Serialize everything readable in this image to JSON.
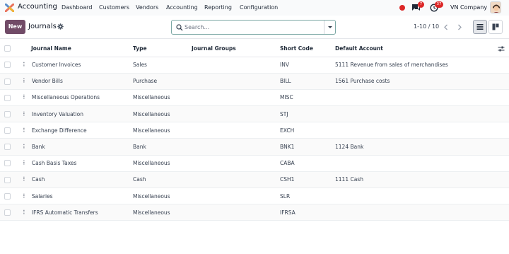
{
  "app": {
    "name": "Accounting",
    "menu": [
      "Dashboard",
      "Customers",
      "Vendors",
      "Accounting",
      "Reporting",
      "Configuration"
    ],
    "chat_count": "7",
    "activity_count": "37",
    "company": "VN Company"
  },
  "control_panel": {
    "new_label": "New",
    "title": "Journals",
    "search_placeholder": "Search...",
    "pager": "1-10 / 10"
  },
  "table": {
    "columns": [
      "Journal Name",
      "Type",
      "Journal Groups",
      "Short Code",
      "Default Account"
    ],
    "rows": [
      {
        "name": "Customer Invoices",
        "type": "Sales",
        "groups": "",
        "code": "INV",
        "account": "5111 Revenue from sales of merchandises"
      },
      {
        "name": "Vendor Bills",
        "type": "Purchase",
        "groups": "",
        "code": "BILL",
        "account": "1561 Purchase costs"
      },
      {
        "name": "Miscellaneous Operations",
        "type": "Miscellaneous",
        "groups": "",
        "code": "MISC",
        "account": ""
      },
      {
        "name": "Inventory Valuation",
        "type": "Miscellaneous",
        "groups": "",
        "code": "STJ",
        "account": ""
      },
      {
        "name": "Exchange Difference",
        "type": "Miscellaneous",
        "groups": "",
        "code": "EXCH",
        "account": ""
      },
      {
        "name": "Bank",
        "type": "Bank",
        "groups": "",
        "code": "BNK1",
        "account": "1124 Bank"
      },
      {
        "name": "Cash Basis Taxes",
        "type": "Miscellaneous",
        "groups": "",
        "code": "CABA",
        "account": ""
      },
      {
        "name": "Cash",
        "type": "Cash",
        "groups": "",
        "code": "CSH1",
        "account": "1111 Cash"
      },
      {
        "name": "Salaries",
        "type": "Miscellaneous",
        "groups": "",
        "code": "SLR",
        "account": ""
      },
      {
        "name": "IFRS Automatic Transfers",
        "type": "Miscellaneous",
        "groups": "",
        "code": "IFRSA",
        "account": ""
      }
    ]
  },
  "colors": {
    "brand": "#714B67",
    "badge": "#dc2626",
    "search_border": "#7ca8a5"
  },
  "icons": [
    "app-logo-icon",
    "chat-icon",
    "activity-icon",
    "gear-icon",
    "search-icon",
    "chevron-down-icon",
    "chevron-left-icon",
    "chevron-right-icon",
    "list-view-icon",
    "kanban-view-icon",
    "drag-handle-icon",
    "column-settings-icon"
  ]
}
